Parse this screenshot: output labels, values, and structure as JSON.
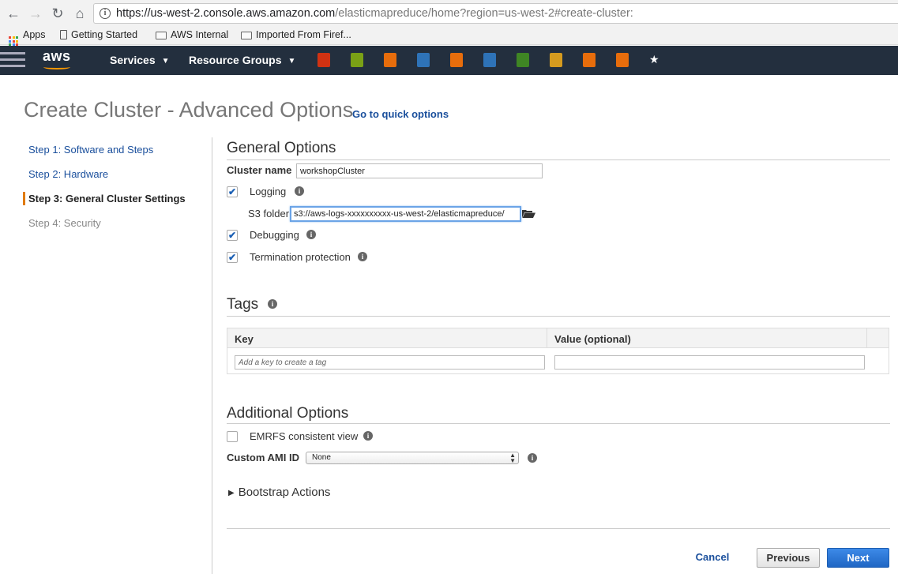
{
  "browser": {
    "url_host": "https://us-west-2.console.aws.amazon.com",
    "url_path": "/elasticmapreduce/home?region=us-west-2#create-cluster:",
    "bookmarks": [
      "Apps",
      "Getting Started",
      "AWS Internal",
      "Imported From Firef..."
    ]
  },
  "aws_nav": {
    "logo": "aws",
    "services": "Services",
    "resource_groups": "Resource Groups",
    "service_icon_colors": [
      "#d13212",
      "#7aa116",
      "#e76d0c",
      "#2e73b8",
      "#e76d0c",
      "#2e73b8",
      "#3f8624",
      "#d59b1f",
      "#e76d0c",
      "#e76d0c",
      "#ffffff"
    ]
  },
  "page": {
    "title": "Create Cluster - Advanced Options",
    "quick_link": "Go to quick options"
  },
  "steps": [
    {
      "label": "Step 1: Software and Steps",
      "state": "link"
    },
    {
      "label": "Step 2: Hardware",
      "state": "link"
    },
    {
      "label": "Step 3: General Cluster Settings",
      "state": "active"
    },
    {
      "label": "Step 4: Security",
      "state": "disabled"
    }
  ],
  "general": {
    "title": "General Options",
    "cluster_name_label": "Cluster name",
    "cluster_name_value": "workshopCluster",
    "logging_label": "Logging",
    "logging_checked": true,
    "s3_label": "S3 folder",
    "s3_value": "s3://aws-logs-xxxxxxxxxx-us-west-2/elasticmapreduce/",
    "debugging_label": "Debugging",
    "debugging_checked": true,
    "termination_label": "Termination protection",
    "termination_checked": true
  },
  "tags": {
    "title": "Tags",
    "col_key": "Key",
    "col_value": "Value (optional)",
    "key_placeholder": "Add a key to create a tag",
    "value_placeholder": ""
  },
  "additional": {
    "title": "Additional Options",
    "emrfs_label": "EMRFS consistent view",
    "emrfs_checked": false,
    "ami_label": "Custom AMI ID",
    "ami_value": "None",
    "bootstrap_label": "Bootstrap Actions"
  },
  "buttons": {
    "cancel": "Cancel",
    "previous": "Previous",
    "next": "Next"
  },
  "icons": {
    "check": "✔",
    "info": "i"
  }
}
